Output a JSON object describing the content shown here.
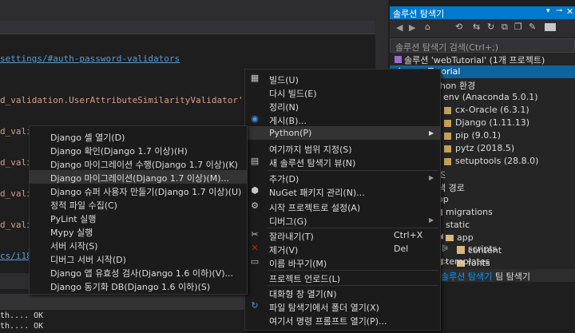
{
  "editor": {
    "lines": [
      {
        "text": "settings/#auth-password-validators",
        "kind": "url"
      },
      {
        "text": "d_validation.UserAttributeSimilarityValidator',",
        "kind": "code"
      },
      {
        "text": "d_valid",
        "kind": "code"
      },
      {
        "text": "d_valid",
        "kind": "code"
      },
      {
        "text": "d_valid",
        "kind": "code"
      },
      {
        "text": "d_valid",
        "kind": "code"
      },
      {
        "text": "cs/i18n",
        "kind": "url"
      }
    ]
  },
  "output": {
    "lines": [
      "th....  OK",
      "th....  OK"
    ]
  },
  "solution_explorer": {
    "title": "솔루션 탐색기",
    "search_placeholder": "솔루션 탐색기 검색(Ctrl+;)",
    "tree": [
      {
        "label": "솔루션 'webTutorial' (1개 프로젝트)"
      },
      {
        "label": "Tutorial"
      },
      {
        "label": "ython 환경"
      },
      {
        "label": "env (Anaconda 5.0.1)"
      },
      {
        "label": "cx-Oracle (6.3.1)"
      },
      {
        "label": "Django (1.11.13)"
      },
      {
        "label": "pip (9.0.1)"
      },
      {
        "label": "pytz (2018.5)"
      },
      {
        "label": "setuptools (28.8.0)"
      },
      {
        "label": "조"
      },
      {
        "label": "색 경로"
      },
      {
        "label": "op"
      },
      {
        "label": "migrations"
      },
      {
        "label": "static"
      },
      {
        "label": "app"
      },
      {
        "label": "content"
      },
      {
        "label": "fonts"
      },
      {
        "label": "scripts"
      },
      {
        "label": "templates"
      }
    ],
    "tabs": [
      "솔루션 탐색기",
      "팀 탐색기"
    ]
  },
  "main_menu": {
    "items": [
      {
        "label": "빌드(U)",
        "shortcut": "",
        "icon": "build-icon"
      },
      {
        "label": "다시 빌드(E)",
        "shortcut": "",
        "icon": ""
      },
      {
        "label": "정리(N)",
        "shortcut": "",
        "icon": ""
      },
      {
        "label": "게시(B)...",
        "shortcut": "",
        "icon": "globe-icon"
      },
      {
        "label": "Python(P)",
        "shortcut": "",
        "icon": ""
      },
      {
        "label": "여기까지 범위 지정(S)",
        "shortcut": "",
        "icon": ""
      },
      {
        "label": "새 솔루션 탐색기 뷰(N)",
        "shortcut": "",
        "icon": "new-view-icon"
      },
      {
        "label": "추가(D)",
        "shortcut": "",
        "icon": ""
      },
      {
        "label": "NuGet 패키지 관리(N)...",
        "shortcut": "",
        "icon": "nuget-icon"
      },
      {
        "label": "시작 프로젝트로 설정(A)",
        "shortcut": "",
        "icon": "gear-icon"
      },
      {
        "label": "디버그(G)",
        "shortcut": "",
        "icon": ""
      },
      {
        "label": "잘라내기(T)",
        "shortcut": "Ctrl+X",
        "icon": "scissors-icon"
      },
      {
        "label": "제거(V)",
        "shortcut": "Del",
        "icon": "delete-icon"
      },
      {
        "label": "이름 바꾸기(M)",
        "shortcut": "",
        "icon": "rename-icon"
      },
      {
        "label": "프로젝트 언로드(L)",
        "shortcut": "",
        "icon": ""
      },
      {
        "label": "대화형 창 열기(N)",
        "shortcut": "",
        "icon": ""
      },
      {
        "label": "파일 탐색기에서 폴더 열기(X)",
        "shortcut": "",
        "icon": "refresh-icon"
      },
      {
        "label": "여기서 명령 프롬프트 열기(P)...",
        "shortcut": "",
        "icon": ""
      }
    ]
  },
  "python_submenu": {
    "items": [
      {
        "label": "Django 셸 열기(D)"
      },
      {
        "label": "Django 확인(Django 1.7 이상)(H)"
      },
      {
        "label": "Django 마이그레이션 수행(Django 1.7 이상)(K)"
      },
      {
        "label": "Django 마이그레이션(Django 1.7 이상)(M)..."
      },
      {
        "label": "Django 슈퍼 사용자 만들기(Django 1.7 이상)(U)"
      },
      {
        "label": "정적 파일 수집(C)"
      },
      {
        "label": "PyLint 실행"
      },
      {
        "label": "Mypy 실행"
      },
      {
        "label": "서버 시작(S)"
      },
      {
        "label": "디버그 서버 시작(D)"
      },
      {
        "label": "Django 앱 유효성 검사(Django 1.6 이하)(V)..."
      },
      {
        "label": "Django 동기화 DB(Django 1.6 이하)(S)"
      }
    ]
  },
  "colors": {
    "accent": "#007acc",
    "menu_bg": "#1b1b1c",
    "highlight": "#333334"
  }
}
